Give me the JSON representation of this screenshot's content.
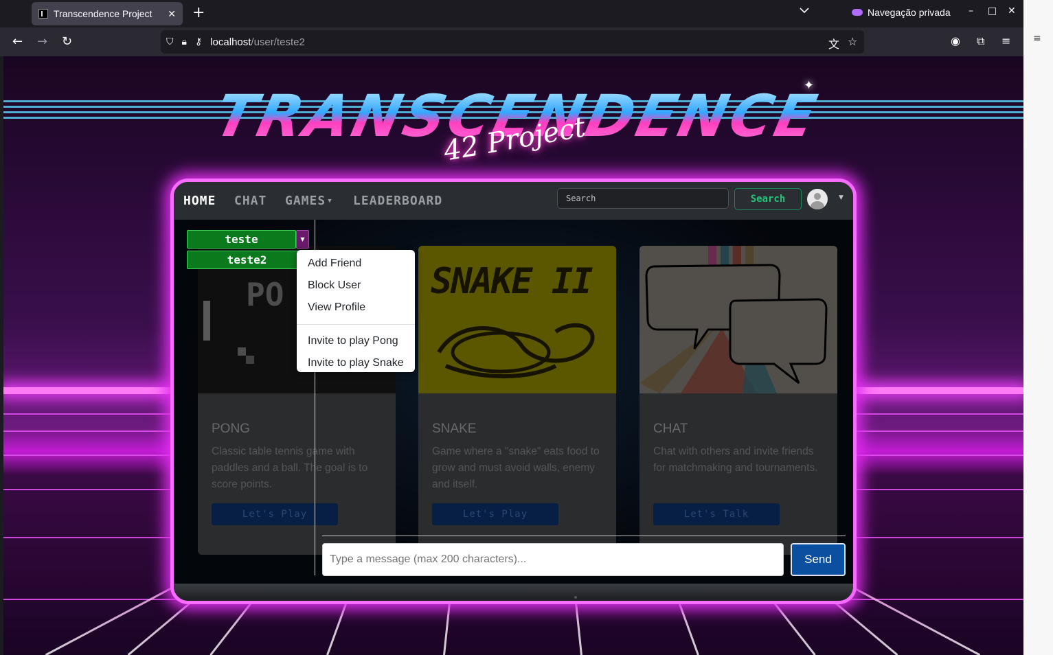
{
  "browser": {
    "tab_title": "Transcendence Project",
    "tab_close": "✕",
    "new_tab": "+",
    "tab_list": "⌄",
    "private_label": "Navegação privada",
    "win_min": "–",
    "win_max": "□",
    "win_close": "✕",
    "url_host": "localhost",
    "url_path": "/user/teste2"
  },
  "logo": {
    "title": "TRANSCENDENCE",
    "subtitle": "42 Project"
  },
  "nav": {
    "home": "HOME",
    "chat": "CHAT",
    "games": "GAMES",
    "leaderboard": "LEADERBOARD",
    "search_placeholder": "Search",
    "search_button": "Search"
  },
  "cards": [
    {
      "title": "PONG",
      "text": "Classic table tennis game with paddles and a ball. The goal is to score points.",
      "button": "Let's Play",
      "image_text": "PO CLA"
    },
    {
      "title": "SNAKE",
      "text": "Game where a \"snake\" eats food to grow and must avoid walls, enemy and itself.",
      "button": "Let's Play",
      "image_text": "SNAKE II"
    },
    {
      "title": "CHAT",
      "text": "Chat with others and invite friends for matchmaking and tournaments.",
      "button": "Let's Talk"
    }
  ],
  "chat": {
    "users": [
      "teste",
      "teste2"
    ],
    "menu": {
      "add_friend": "Add Friend",
      "block_user": "Block User",
      "view_profile": "View Profile",
      "invite_pong": "Invite to play Pong",
      "invite_snake": "Invite to play Snake"
    },
    "message_placeholder": "Type a message (max 200 characters)...",
    "send": "Send"
  },
  "colors": {
    "frame_glow": "#e12ef0",
    "user_button": "#0a7a1c",
    "send_button": "#0b4fa0",
    "search_button_border": "#198754"
  }
}
